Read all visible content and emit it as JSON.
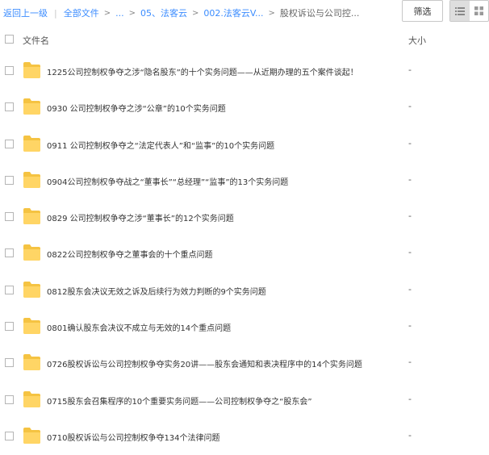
{
  "breadcrumb": {
    "back": "返回上一级",
    "separator": "|",
    "all_files": "全部文件",
    "ellipsis": "...",
    "arrow": ">",
    "folder_1": "05、法客云",
    "folder_2": "002.法客云V...",
    "current": "股权诉讼与公司控..."
  },
  "toolbar": {
    "filter_label": "筛选",
    "list_view_icon": "list-icon",
    "grid_view_icon": "grid-icon"
  },
  "table": {
    "columns": {
      "name": "文件名",
      "size": "大小"
    },
    "rows": [
      {
        "name": "1225公司控制权争夺之涉“隐名股东”的十个实务问题——从近期办理的五个案件谈起！",
        "size": "-"
      },
      {
        "name": "0930 公司控制权争夺之涉“公章”的10个实务问题",
        "size": "-"
      },
      {
        "name": "0911 公司控制权争夺之“法定代表人”和“监事”的10个实务问题",
        "size": "-"
      },
      {
        "name": "0904公司控制权争夺战之“董事长”“总经理”“监事”的13个实务问题",
        "size": "-"
      },
      {
        "name": "0829 公司控制权争夺之涉“董事长”的12个实务问题",
        "size": "-"
      },
      {
        "name": "0822公司控制权争夺之董事会的十个重点问题",
        "size": "-"
      },
      {
        "name": "0812股东会决议无效之诉及后续行为效力判断的9个实务问题",
        "size": "-"
      },
      {
        "name": "0801确认股东会决议不成立与无效的14个重点问题",
        "size": "-"
      },
      {
        "name": "0726股权诉讼与公司控制权争夺实务20讲——股东会通知和表决程序中的14个实务问题",
        "size": "-"
      },
      {
        "name": "0715股东会召集程序的10个重要实务问题——公司控制权争夺之“股东会”",
        "size": "-"
      },
      {
        "name": "0710股权诉讼与公司控制权争夺134个法律问题",
        "size": "-"
      }
    ]
  },
  "colors": {
    "link": "#3b8cff",
    "folder": "#ffd565",
    "folder_tab": "#f5c342"
  }
}
